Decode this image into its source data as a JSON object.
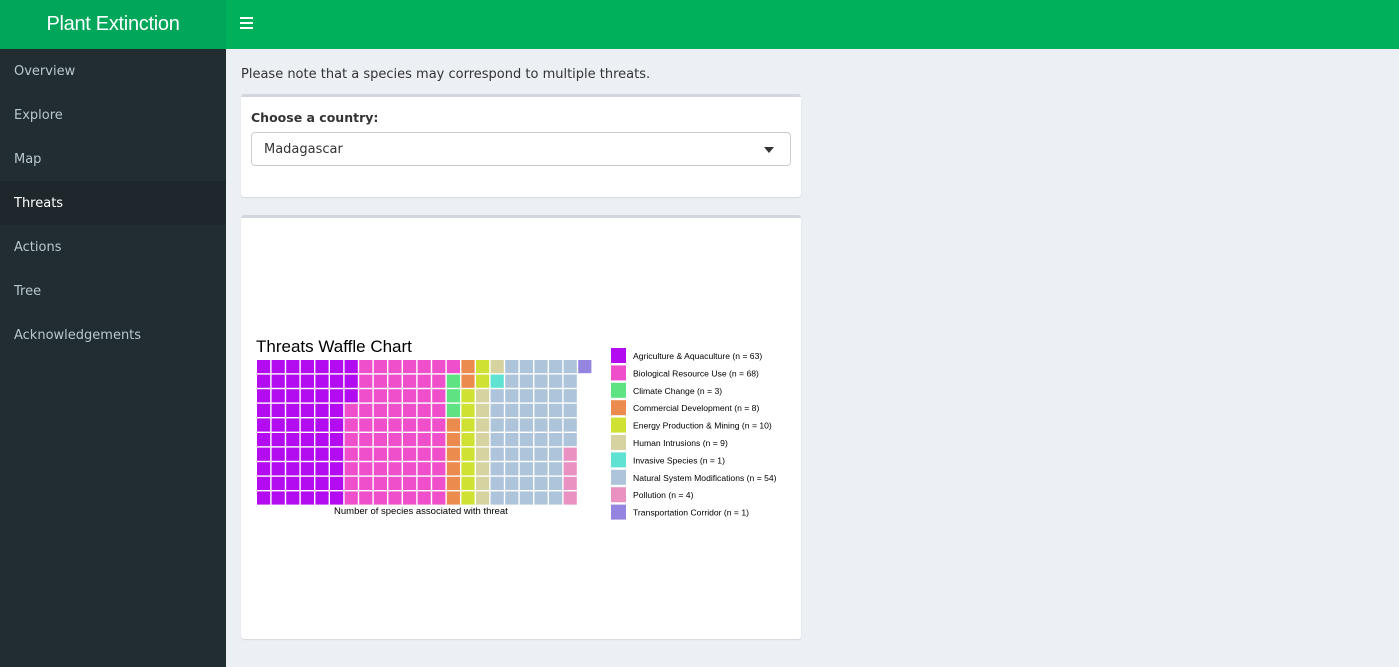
{
  "app": {
    "title": "Plant Extinction"
  },
  "sidebar": {
    "items": [
      {
        "label": "Overview",
        "active": false
      },
      {
        "label": "Explore",
        "active": false
      },
      {
        "label": "Map",
        "active": false
      },
      {
        "label": "Threats",
        "active": true
      },
      {
        "label": "Actions",
        "active": false
      },
      {
        "label": "Tree",
        "active": false
      },
      {
        "label": "Acknowledgements",
        "active": false
      }
    ]
  },
  "main": {
    "note": "Please note that a species may correspond to multiple threats.",
    "country_select": {
      "label": "Choose a country:",
      "value": "Madagascar"
    }
  },
  "colors": {
    "header": "#00b05a",
    "logo": "#00a65a",
    "sidebar": "#222d32"
  },
  "chart_data": {
    "type": "waffle",
    "title": "Threats Waffle Chart",
    "xlabel": "Number of species associated with threat",
    "rows": 10,
    "series": [
      {
        "name": "Agriculture & Aquaculture",
        "label": "Agriculture & Aquaculture (n = 63)",
        "value": 63,
        "color": "#b30cf0"
      },
      {
        "name": "Biological Resource Use",
        "label": "Biological Resource Use (n = 68)",
        "value": 68,
        "color": "#ef4fcb"
      },
      {
        "name": "Climate Change",
        "label": "Climate Change (n = 3)",
        "value": 3,
        "color": "#5ee383"
      },
      {
        "name": "Commercial Development",
        "label": "Commercial Development (n = 8)",
        "value": 8,
        "color": "#ec8b4e"
      },
      {
        "name": "Energy Production & Mining",
        "label": "Energy Production & Mining (n = 10)",
        "value": 10,
        "color": "#cfe234"
      },
      {
        "name": "Human Intrusions",
        "label": "Human Intrusions (n = 9)",
        "value": 9,
        "color": "#d7d3a1"
      },
      {
        "name": "Invasive Species",
        "label": "Invasive Species (n = 1)",
        "value": 1,
        "color": "#5fe2d2"
      },
      {
        "name": "Natural System Modifications",
        "label": "Natural System Modifications (n = 54)",
        "value": 54,
        "color": "#adc4db"
      },
      {
        "name": "Pollution",
        "label": "Pollution (n = 4)",
        "value": 4,
        "color": "#e991c1"
      },
      {
        "name": "Transportation Corridor",
        "label": "Transportation Corridor (n = 1)",
        "value": 1,
        "color": "#9585e1"
      }
    ]
  }
}
